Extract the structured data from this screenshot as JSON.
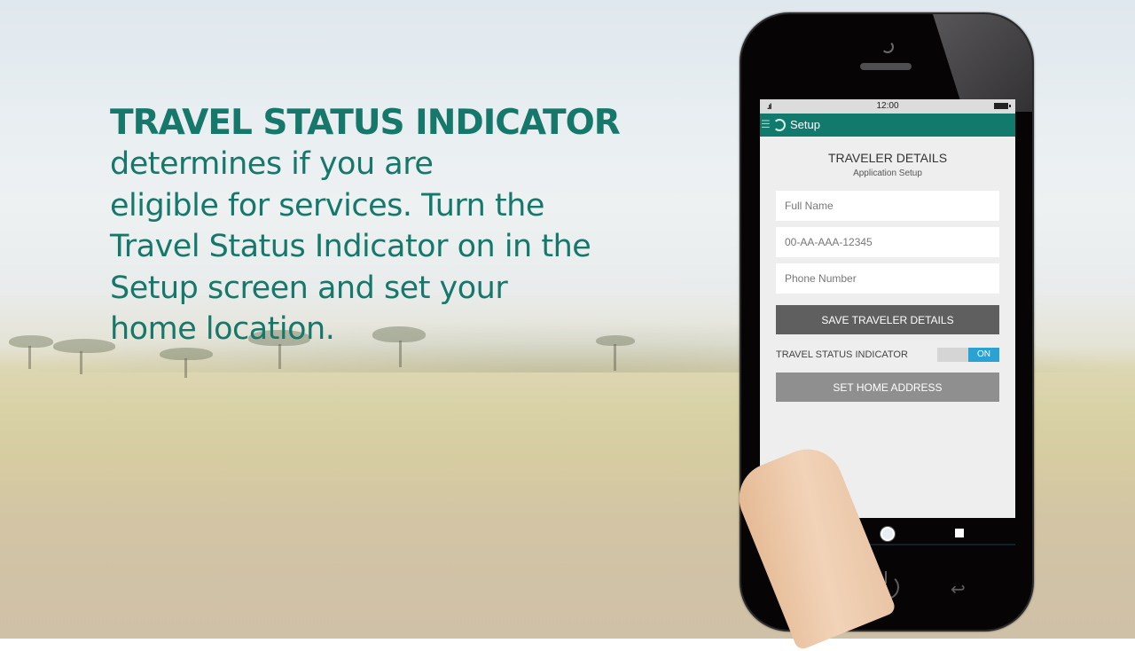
{
  "headline": {
    "title": "TRAVEL STATUS INDICATOR",
    "body": "determines if you are\neligible for services. Turn the\nTravel Status Indicator on in the\nSetup screen and set your\nhome location."
  },
  "colors": {
    "brand_teal": "#127a6c",
    "headline_teal": "#16786a",
    "toggle_on": "#2aa2d3",
    "save_button": "#5f5f5f",
    "home_button": "#8f8f8f"
  },
  "phone": {
    "status_bar": {
      "signal_icon": "signal-icon",
      "time": "12:00",
      "battery_icon": "battery-icon"
    },
    "app_bar": {
      "menu_icon": "hamburger-menu-icon",
      "logo_icon": "app-logo-icon",
      "title": "Setup"
    },
    "screen": {
      "section_title": "TRAVELER DETAILS",
      "section_subtitle": "Application Setup",
      "fields": [
        {
          "placeholder": "Full Name",
          "value": ""
        },
        {
          "placeholder": "00-AA-AAA-12345",
          "value": ""
        },
        {
          "placeholder": "Phone Number",
          "value": ""
        }
      ],
      "save_button": "SAVE TRAVELER DETAILS",
      "toggle": {
        "label": "TRAVEL STATUS INDICATOR",
        "state": "ON"
      },
      "home_button": "SET HOME ADDRESS"
    },
    "nav_bar": [
      "back-icon",
      "home-icon",
      "recent-apps-icon"
    ],
    "hardware_buttons": [
      "power-icon",
      "return-icon"
    ]
  }
}
